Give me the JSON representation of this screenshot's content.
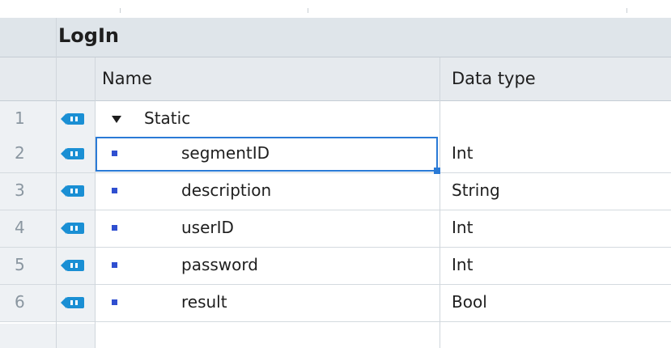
{
  "block": {
    "title": "LogIn"
  },
  "columns": {
    "name": "Name",
    "data_type": "Data type"
  },
  "rows": [
    {
      "index": "1",
      "name": "Static",
      "data_type": "",
      "kind": "group",
      "expanded": true
    },
    {
      "index": "2",
      "name": "segmentID",
      "data_type": "Int",
      "kind": "variable",
      "selected": true
    },
    {
      "index": "3",
      "name": "description",
      "data_type": "String",
      "kind": "variable"
    },
    {
      "index": "4",
      "name": "userID",
      "data_type": "Int",
      "kind": "variable"
    },
    {
      "index": "5",
      "name": "password",
      "data_type": "Int",
      "kind": "variable"
    },
    {
      "index": "6",
      "name": "result",
      "data_type": "Bool",
      "kind": "variable"
    }
  ],
  "icons": {
    "row_icon": "static-port-icon",
    "group_toggle": "expand-triangle-icon",
    "variable_marker": "variable-bullet-icon",
    "type_picker": "list-picker-icon"
  },
  "colors": {
    "selection": "#2a7ad6",
    "bullet": "#2f4fd0",
    "icon_blue": "#1a8fd4",
    "header_bg": "#e6eaee"
  }
}
